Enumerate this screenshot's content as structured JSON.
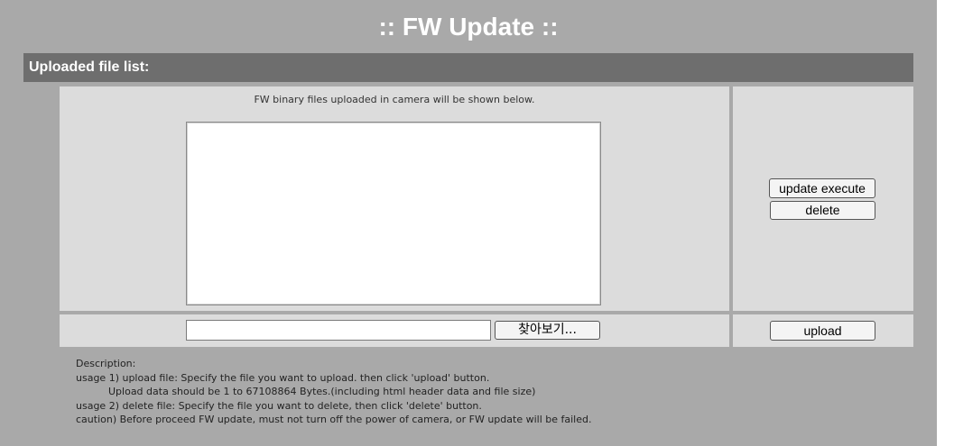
{
  "page": {
    "title": ":: FW Update ::"
  },
  "section": {
    "header": "Uploaded file list:",
    "list_hint": "FW binary files uploaded in camera will be shown below."
  },
  "actions": {
    "update_execute": "update execute",
    "delete": "delete",
    "upload": "upload"
  },
  "file_select": {
    "value": "",
    "browse_label": "찾아보기..."
  },
  "description": {
    "heading": "Description:",
    "lines": [
      "usage 1) upload file: Specify the file you want to upload. then click 'upload' button.",
      "Upload data should be 1 to 67108864 Bytes.(including html header data and file size)",
      "usage 2) delete file: Specify the file you want to delete, then click 'delete' button.",
      "caution) Before proceed FW update, must not turn off the power of camera, or FW update will be failed."
    ]
  },
  "colors": {
    "background": "#a9a9a9",
    "section_header": "#6e6e6e",
    "panel": "#dcdcdc"
  }
}
